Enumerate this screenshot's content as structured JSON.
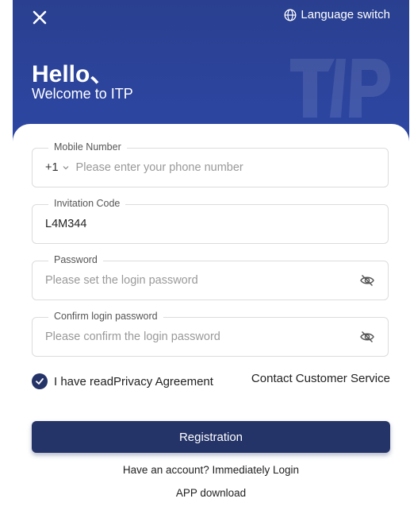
{
  "header": {
    "close_icon": "close-icon",
    "language_icon": "globe-icon",
    "language_label": "Language switch",
    "greeting": "Hello、",
    "welcome": "Welcome to ITP",
    "watermark_text": "ITP",
    "colors": {
      "hero": "#2d48a6",
      "primary": "#253468"
    }
  },
  "form": {
    "mobile": {
      "label": "Mobile Number",
      "country_code": "+1",
      "value": "",
      "placeholder": "Please enter your phone number"
    },
    "invitation": {
      "label": "Invitation Code",
      "value": "L4M344",
      "placeholder": ""
    },
    "password": {
      "label": "Password",
      "value": "",
      "placeholder": "Please set the login password",
      "icon": "eye-off-icon"
    },
    "confirm": {
      "label": "Confirm login password",
      "value": "",
      "placeholder": "Please confirm the login password",
      "icon": "eye-off-icon"
    }
  },
  "agreement": {
    "checked": true,
    "text": "I have readPrivacy Agreement"
  },
  "contact_label": "Contact Customer Service",
  "register_label": "Registration",
  "login_prompt": "Have an account? Immediately Login",
  "app_download": "APP download"
}
